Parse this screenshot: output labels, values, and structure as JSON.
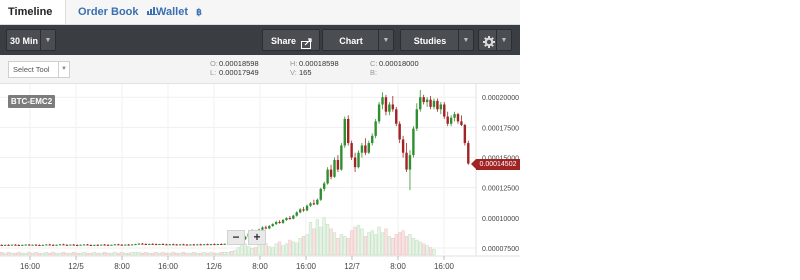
{
  "tabs": [
    {
      "label": "Timeline",
      "icon": ""
    },
    {
      "label": "Order Book",
      "icon": "depth-chart-icon"
    },
    {
      "label": "Wallet",
      "icon": "bitcoin-icon"
    }
  ],
  "toolbar": {
    "interval": "30 Min",
    "share": "Share",
    "chart": "Chart",
    "studies": "Studies",
    "settings_icon": "gear-icon"
  },
  "select_tool": "Select Tool",
  "ohlc": {
    "o_key": "O:",
    "o": "0.00018598",
    "h_key": "H:",
    "h": "0.00018598",
    "c_key": "C:",
    "c": "0.00018000",
    "l_key": "L:",
    "l": "0.00017949",
    "v_key": "V:",
    "v": "165",
    "b_key": "B:",
    "b": ""
  },
  "pair": "BTC-EMC2",
  "zoom": {
    "minus": "−",
    "plus": "+"
  },
  "current_price": "0.00014502",
  "colors": {
    "up": "#2f8f2f",
    "down": "#a12424",
    "toolbar": "#3a3d42"
  },
  "chart_data": {
    "type": "candlestick",
    "x_ticks": [
      "16:00",
      "12/5",
      "8:00",
      "16:00",
      "12/6",
      "8:00",
      "16:00",
      "12/7",
      "8:00",
      "16:00"
    ],
    "y_ticks": [
      "0.00020000",
      "0.00017500",
      "0.00015000",
      "0.00012500",
      "0.00010000",
      "0.00007500"
    ],
    "ylim": [
      7e-05,
      0.000206
    ],
    "candles": [
      [
        7.75e-05,
        7.8e-05,
        7.7e-05,
        7.72e-05
      ],
      [
        7.72e-05,
        7.78e-05,
        7.68e-05,
        7.76e-05
      ],
      [
        7.76e-05,
        7.81e-05,
        7.71e-05,
        7.74e-05
      ],
      [
        7.74e-05,
        7.79e-05,
        7.7e-05,
        7.77e-05
      ],
      [
        7.77e-05,
        7.82e-05,
        7.72e-05,
        7.75e-05
      ],
      [
        7.75e-05,
        7.8e-05,
        7.7e-05,
        7.73e-05
      ],
      [
        7.73e-05,
        7.78e-05,
        7.69e-05,
        7.76e-05
      ],
      [
        7.76e-05,
        7.81e-05,
        7.72e-05,
        7.78e-05
      ],
      [
        7.78e-05,
        7.83e-05,
        7.73e-05,
        7.74e-05
      ],
      [
        7.74e-05,
        7.79e-05,
        7.7e-05,
        7.77e-05
      ],
      [
        7.77e-05,
        7.82e-05,
        7.72e-05,
        7.75e-05
      ],
      [
        7.75e-05,
        7.8e-05,
        7.7e-05,
        7.72e-05
      ],
      [
        7.72e-05,
        7.77e-05,
        7.68e-05,
        7.76e-05
      ],
      [
        7.76e-05,
        7.81e-05,
        7.71e-05,
        7.79e-05
      ],
      [
        7.79e-05,
        7.84e-05,
        7.74e-05,
        7.76e-05
      ],
      [
        7.76e-05,
        7.81e-05,
        7.71e-05,
        7.73e-05
      ],
      [
        7.73e-05,
        7.78e-05,
        7.69e-05,
        7.77e-05
      ],
      [
        7.77e-05,
        7.82e-05,
        7.72e-05,
        7.8e-05
      ],
      [
        7.8e-05,
        7.85e-05,
        7.75e-05,
        7.76e-05
      ],
      [
        7.76e-05,
        7.81e-05,
        7.71e-05,
        7.74e-05
      ],
      [
        7.74e-05,
        7.79e-05,
        7.7e-05,
        7.78e-05
      ],
      [
        7.78e-05,
        7.83e-05,
        7.73e-05,
        7.75e-05
      ],
      [
        7.75e-05,
        7.8e-05,
        7.7e-05,
        7.73e-05
      ],
      [
        7.73e-05,
        7.78e-05,
        7.69e-05,
        7.77e-05
      ],
      [
        7.77e-05,
        7.82e-05,
        7.72e-05,
        7.79e-05
      ],
      [
        7.79e-05,
        7.84e-05,
        7.74e-05,
        7.75e-05
      ],
      [
        7.75e-05,
        7.8e-05,
        7.7e-05,
        7.72e-05
      ],
      [
        7.72e-05,
        7.77e-05,
        7.68e-05,
        7.76e-05
      ],
      [
        7.76e-05,
        7.81e-05,
        7.71e-05,
        7.74e-05
      ],
      [
        7.74e-05,
        7.79e-05,
        7.7e-05,
        7.78e-05
      ],
      [
        7.78e-05,
        7.83e-05,
        7.73e-05,
        7.76e-05
      ],
      [
        7.76e-05,
        7.81e-05,
        7.71e-05,
        7.73e-05
      ],
      [
        7.73e-05,
        7.78e-05,
        7.69e-05,
        7.77e-05
      ],
      [
        7.77e-05,
        7.82e-05,
        7.72e-05,
        7.8e-05
      ],
      [
        7.8e-05,
        7.85e-05,
        7.75e-05,
        7.77e-05
      ],
      [
        7.77e-05,
        7.82e-05,
        7.72e-05,
        7.75e-05
      ],
      [
        7.75e-05,
        7.8e-05,
        7.7e-05,
        7.78e-05
      ],
      [
        7.78e-05,
        7.83e-05,
        7.73e-05,
        7.76e-05
      ],
      [
        7.76e-05,
        7.81e-05,
        7.71e-05,
        7.79e-05
      ],
      [
        7.79e-05,
        7.85e-05,
        7.74e-05,
        7.82e-05
      ],
      [
        7.82e-05,
        7.9e-05,
        7.77e-05,
        7.86e-05
      ],
      [
        7.86e-05,
        7.92e-05,
        7.8e-05,
        7.83e-05
      ],
      [
        7.83e-05,
        7.88e-05,
        7.78e-05,
        7.81e-05
      ],
      [
        7.81e-05,
        7.86e-05,
        7.76e-05,
        7.84e-05
      ],
      [
        7.84e-05,
        7.89e-05,
        7.79e-05,
        7.82e-05
      ],
      [
        7.82e-05,
        7.87e-05,
        7.77e-05,
        7.79e-05
      ],
      [
        7.79e-05,
        7.84e-05,
        7.74e-05,
        7.83e-05
      ],
      [
        7.83e-05,
        7.88e-05,
        7.78e-05,
        7.8e-05
      ],
      [
        7.8e-05,
        7.85e-05,
        7.75e-05,
        7.78e-05
      ],
      [
        7.78e-05,
        7.83e-05,
        7.73e-05,
        7.81e-05
      ],
      [
        7.81e-05,
        7.86e-05,
        7.76e-05,
        7.79e-05
      ],
      [
        7.79e-05,
        7.84e-05,
        7.74e-05,
        7.77e-05
      ],
      [
        7.77e-05,
        7.82e-05,
        7.72e-05,
        7.8e-05
      ],
      [
        7.8e-05,
        7.85e-05,
        7.75e-05,
        7.78e-05
      ],
      [
        7.78e-05,
        7.83e-05,
        7.73e-05,
        7.76e-05
      ],
      [
        7.76e-05,
        7.81e-05,
        7.71e-05,
        7.79e-05
      ],
      [
        7.79e-05,
        7.84e-05,
        7.74e-05,
        7.77e-05
      ],
      [
        7.77e-05,
        7.82e-05,
        7.72e-05,
        7.8e-05
      ],
      [
        7.8e-05,
        7.85e-05,
        7.75e-05,
        7.78e-05
      ],
      [
        7.78e-05,
        7.83e-05,
        7.73e-05,
        7.81e-05
      ],
      [
        7.81e-05,
        7.86e-05,
        7.76e-05,
        7.79e-05
      ],
      [
        7.79e-05,
        7.84e-05,
        7.74e-05,
        7.82e-05
      ],
      [
        7.82e-05,
        7.87e-05,
        7.77e-05,
        7.8e-05
      ],
      [
        7.8e-05,
        7.85e-05,
        7.75e-05,
        7.83e-05
      ],
      [
        7.83e-05,
        7.88e-05,
        7.78e-05,
        7.81e-05
      ],
      [
        7.81e-05,
        7.87e-05,
        7.76e-05,
        7.85e-05
      ],
      [
        7.85e-05,
        7.9e-05,
        7.8e-05,
        7.88e-05
      ],
      [
        7.88e-05,
        7.94e-05,
        7.82e-05,
        7.86e-05
      ],
      [
        7.86e-05,
        7.92e-05,
        7.8e-05,
        7.9e-05
      ],
      [
        7.9e-05,
        8e-05,
        7.86e-05,
        7.96e-05
      ],
      [
        7.96e-05,
        8.3e-05,
        7.9e-05,
        8.24e-05
      ],
      [
        8.24e-05,
        8.5e-05,
        8.15e-05,
        8.42e-05
      ],
      [
        8.42e-05,
        8.8e-05,
        8.35e-05,
        8.7e-05
      ],
      [
        8.7e-05,
        9.05e-05,
        8.6e-05,
        8.9e-05
      ],
      [
        8.9e-05,
        9e-05,
        8.7e-05,
        8.78e-05
      ],
      [
        8.78e-05,
        9.1e-05,
        8.72e-05,
        9.02e-05
      ],
      [
        9.02e-05,
        9.3e-05,
        8.95e-05,
        9.2e-05
      ],
      [
        9.2e-05,
        9.35e-05,
        9.05e-05,
        9.12e-05
      ],
      [
        9.12e-05,
        9.4e-05,
        9.05e-05,
        9.32e-05
      ],
      [
        9.32e-05,
        9.55e-05,
        9.25e-05,
        9.48e-05
      ],
      [
        9.48e-05,
        9.75e-05,
        9.4e-05,
        9.65e-05
      ],
      [
        9.65e-05,
        9.8e-05,
        9.52e-05,
        9.58e-05
      ],
      [
        9.58e-05,
        9.9e-05,
        9.5e-05,
        9.82e-05
      ],
      [
        9.82e-05,
        0.0001005,
        9.75e-05,
        9.98e-05
      ],
      [
        9.98e-05,
        0.0001015,
        9.85e-05,
        9.92e-05
      ],
      [
        9.92e-05,
        0.0001025,
        9.88e-05,
        0.0001018
      ],
      [
        0.0001018,
        0.0001055,
        0.000101,
        0.0001045
      ],
      [
        0.0001045,
        0.000108,
        0.0001038,
        0.000107
      ],
      [
        0.000107,
        0.000109,
        0.000105,
        0.0001062
      ],
      [
        0.0001062,
        0.000111,
        0.0001055,
        0.00011
      ],
      [
        0.00011,
        0.000113,
        0.000109,
        0.000112
      ],
      [
        0.000112,
        0.000115,
        0.0001105,
        0.0001112
      ],
      [
        0.0001112,
        0.000116,
        0.0001105,
        0.000115
      ],
      [
        0.000115,
        0.000125,
        0.000114,
        0.000124
      ],
      [
        0.000124,
        0.00013,
        0.000122,
        0.0001285
      ],
      [
        0.0001285,
        0.000142,
        0.0001275,
        0.00014
      ],
      [
        0.00014,
        0.000144,
        0.000132,
        0.000134
      ],
      [
        0.000134,
        0.00015,
        0.000133,
        0.000148
      ],
      [
        0.000148,
        0.000152,
        0.000138,
        0.00014
      ],
      [
        0.00014,
        0.000162,
        0.000139,
        0.00016
      ],
      [
        0.00016,
        0.000184,
        0.000158,
        0.000182
      ],
      [
        0.000182,
        0.000185,
        0.00016,
        0.000162
      ],
      [
        0.000162,
        0.000164,
        0.000148,
        0.00015
      ],
      [
        0.00015,
        0.000154,
        0.000138,
        0.000142
      ],
      [
        0.000142,
        0.000156,
        0.000141,
        0.000154
      ],
      [
        0.000154,
        0.000162,
        0.00015,
        0.00016
      ],
      [
        0.00016,
        0.000166,
        0.000152,
        0.000154
      ],
      [
        0.000154,
        0.000164,
        0.000153,
        0.000162
      ],
      [
        0.000162,
        0.00017,
        0.00016,
        0.000168
      ],
      [
        0.000168,
        0.000182,
        0.000166,
        0.00018
      ],
      [
        0.00018,
        0.000196,
        0.000178,
        0.000194
      ],
      [
        0.000194,
        0.000204,
        0.00019,
        0.0002
      ],
      [
        0.0002,
        0.000202,
        0.000185,
        0.000188
      ],
      [
        0.000188,
        0.000196,
        0.000185,
        0.000194
      ],
      [
        0.000194,
        0.000201,
        0.000188,
        0.00019
      ],
      [
        0.00019,
        0.000192,
        0.000176,
        0.000178
      ],
      [
        0.000178,
        0.00018,
        0.000162,
        0.000165
      ],
      [
        0.000165,
        0.000168,
        0.00015,
        0.000154
      ],
      [
        0.000154,
        0.000162,
        0.000138,
        0.00014
      ],
      [
        0.00014,
        0.000156,
        0.000123,
        0.000152
      ],
      [
        0.000152,
        0.000176,
        0.00015,
        0.000174
      ],
      [
        0.000174,
        0.000195,
        0.000172,
        0.00019
      ],
      [
        0.00019,
        0.000206,
        0.000188,
        0.0002
      ],
      [
        0.0002,
        0.000202,
        0.000194,
        0.000196
      ],
      [
        0.000196,
        0.0002,
        0.000192,
        0.000198
      ],
      [
        0.000198,
        0.000201,
        0.00019,
        0.000192
      ],
      [
        0.000192,
        0.000199,
        0.00019,
        0.000197
      ],
      [
        0.000197,
        0.000199,
        0.000188,
        0.00019
      ],
      [
        0.00019,
        0.000196,
        0.000186,
        0.000194
      ],
      [
        0.000194,
        0.000196,
        0.000182,
        0.000184
      ],
      [
        0.000184,
        0.000188,
        0.000176,
        0.000178
      ],
      [
        0.000178,
        0.000185,
        0.000176,
        0.000183
      ],
      [
        0.000183,
        0.000188,
        0.00018,
        0.000186
      ],
      [
        0.000186,
        0.000187,
        0.000178,
        0.00018
      ],
      [
        0.00018,
        0.000185,
        0.000176,
        0.000177
      ],
      [
        0.000177,
        0.000178,
        0.00016,
        0.000162
      ],
      [
        0.000162,
        0.000164,
        0.000144,
        0.000145
      ]
    ],
    "volume_scale": [
      0,
      45
    ],
    "volumes": [
      3,
      2,
      3,
      2,
      2,
      3,
      2,
      2,
      3,
      2,
      3,
      2,
      2,
      3,
      2,
      3,
      2,
      2,
      3,
      2,
      2,
      3,
      2,
      2,
      3,
      2,
      2,
      3,
      2,
      2,
      3,
      2,
      2,
      3,
      2,
      3,
      2,
      2,
      3,
      3,
      3,
      2,
      3,
      2,
      2,
      3,
      2,
      3,
      2,
      2,
      3,
      2,
      2,
      3,
      2,
      2,
      3,
      2,
      2,
      3,
      2,
      3,
      2,
      2,
      3,
      3,
      3,
      4,
      5,
      8,
      10,
      12,
      9,
      7,
      8,
      11,
      10,
      12,
      9,
      8,
      12,
      14,
      10,
      12,
      16,
      14,
      13,
      18,
      20,
      22,
      35,
      28,
      38,
      30,
      40,
      33,
      28,
      24,
      18,
      22,
      20,
      18,
      26,
      30,
      32,
      28,
      20,
      24,
      26,
      22,
      30,
      24,
      28,
      20,
      18,
      22,
      24,
      26,
      20,
      22,
      18,
      16,
      14,
      12,
      10,
      8,
      6
    ]
  }
}
